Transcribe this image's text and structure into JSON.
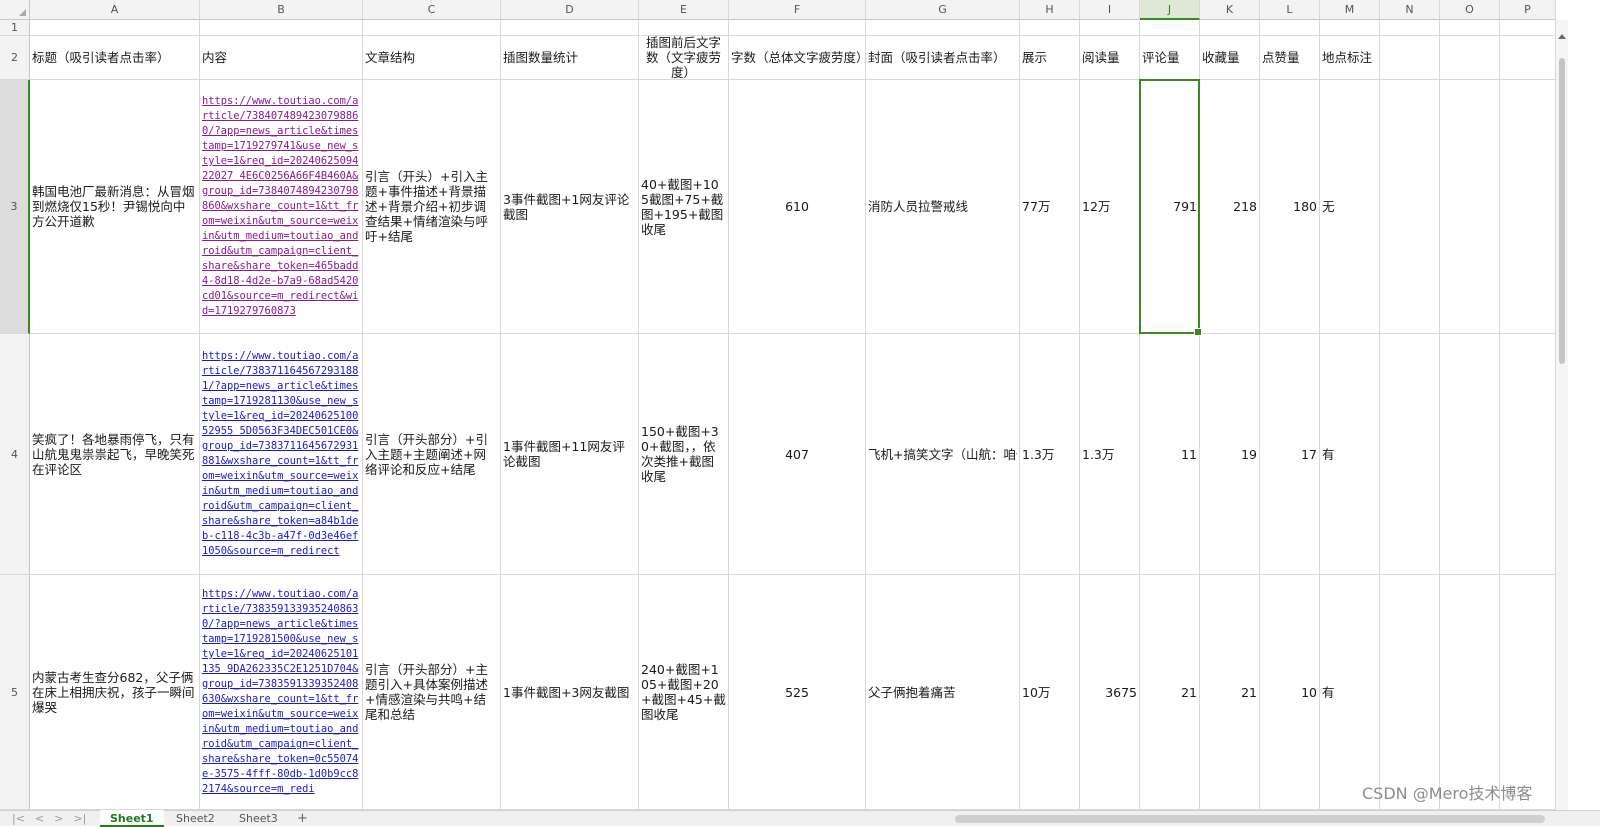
{
  "columns": [
    "A",
    "B",
    "C",
    "D",
    "E",
    "F",
    "G",
    "H",
    "I",
    "J",
    "K",
    "L",
    "M",
    "N",
    "O",
    "P"
  ],
  "selected_column": "J",
  "row_numbers": [
    "1",
    "2",
    "3",
    "4",
    "5"
  ],
  "selected_row": "3",
  "headers": [
    "标题（吸引读者点击率）",
    "内容",
    "文章结构",
    "插图数量统计",
    "插图前后文字数（文字疲劳度）",
    "字数（总体文字疲劳度）",
    "封面（吸引读者点击率）",
    "展示",
    "阅读量",
    "评论量",
    "收藏量",
    "点赞量",
    "地点标注"
  ],
  "rows": [
    {
      "title": "韩国电池厂最新消息：从冒烟到燃烧仅15秒！尹锡悦向中方公开道歉",
      "content_url": "https://www.toutiao.com/article/7384074894230798860/?app=news_article&timestamp=1719279741&use_new_style=1&req_id=2024062509422027 4E6C0256A66F4B460A&group_id=7384074894230798860&wxshare_count=1&tt_from=weixin&utm_source=weixin&utm_medium=toutiao_android&utm_campaign=client_share&share_token=465badd4-8d18-4d2e-b7a9-68ad5420cd01&source=m_redirect&wid=1719279760873",
      "structure": "引言（开头）+引入主题+事件描述+背景描述+背景介绍+初步调查结果+情绪渲染与呼吁+结尾",
      "image_count": "3事件截图+1网友评论截图",
      "text_around_images": "40+截图+105截图+75+截图+195+截图收尾",
      "word_count": "610",
      "cover": "消防人员拉警戒线",
      "impressions": "77万",
      "reads": "12万",
      "comments": "791",
      "favorites": "218",
      "likes": "180",
      "location": "无"
    },
    {
      "title": "笑疯了！各地暴雨停飞，只有山航鬼鬼祟祟起飞，早晚笑死在评论区",
      "content_url": "https://www.toutiao.com/article/7383711645672931881/?app=news_article&timestamp=1719281130&use_new_style=1&req_id=2024062510052955 5D0563F34DEC501CE0&group_id=7383711645672931881&wxshare_count=1&tt_from=weixin&utm_source=weixin&utm_medium=toutiao_android&utm_campaign=client_share&share_token=a84b1deb-c118-4c3b-a47f-0d3e46ef1050&source=m_redirect",
      "structure": "引言（开头部分）+引入主题+主题阐述+网络评论和反应+结尾",
      "image_count": "1事件截图+11网友评论截图",
      "text_around_images": "150+截图+30+截图，，依次类推+截图收尾",
      "word_count": "407",
      "cover": "飞机+搞笑文字（山航：咱俩悄悄的",
      "impressions": "1.3万",
      "reads": "1.3万",
      "comments": "11",
      "favorites": "19",
      "likes": "17",
      "location": "有"
    },
    {
      "title": "内蒙古考生查分682，父子俩在床上相拥庆祝，孩子一瞬间爆哭",
      "content_url": "https://www.toutiao.com/article/7383591339352408630/?app=news_article&timestamp=1719281500&use_new_style=1&req_id=20240625101135 9DA262335C2E1251D704&group_id=7383591339352408630&wxshare_count=1&tt_from=weixin&utm_source=weixin&utm_medium=toutiao_android&utm_campaign=client_share&share_token=0c55074e-3575-4fff-80db-1d0b9cc82174&source=m_redi",
      "structure": "引言（开头部分）+主题引入+具体案例描述+情感渲染与共鸣+结尾和总结",
      "image_count": "1事件截图+3网友截图",
      "text_around_images": "240+截图+105+截图+20+截图+45+截图收尾",
      "word_count": "525",
      "cover": "父子俩抱着痛苦",
      "impressions": "10万",
      "reads": "3675",
      "comments": "21",
      "favorites": "21",
      "likes": "10",
      "location": "有"
    }
  ],
  "sheet_tabs": [
    "Sheet1",
    "Sheet2",
    "Sheet3"
  ],
  "active_sheet": "Sheet1",
  "add_sheet_label": "+",
  "nav_arrows": [
    "|<",
    "<",
    ">",
    ">|"
  ],
  "watermark": "CSDN @Mero技术博客",
  "colors": {
    "accent": "#3a8a24",
    "link_visited": "#8b1a8b",
    "link_unvisited": "#1a1acd",
    "header_bg": "#f3f3f3"
  }
}
